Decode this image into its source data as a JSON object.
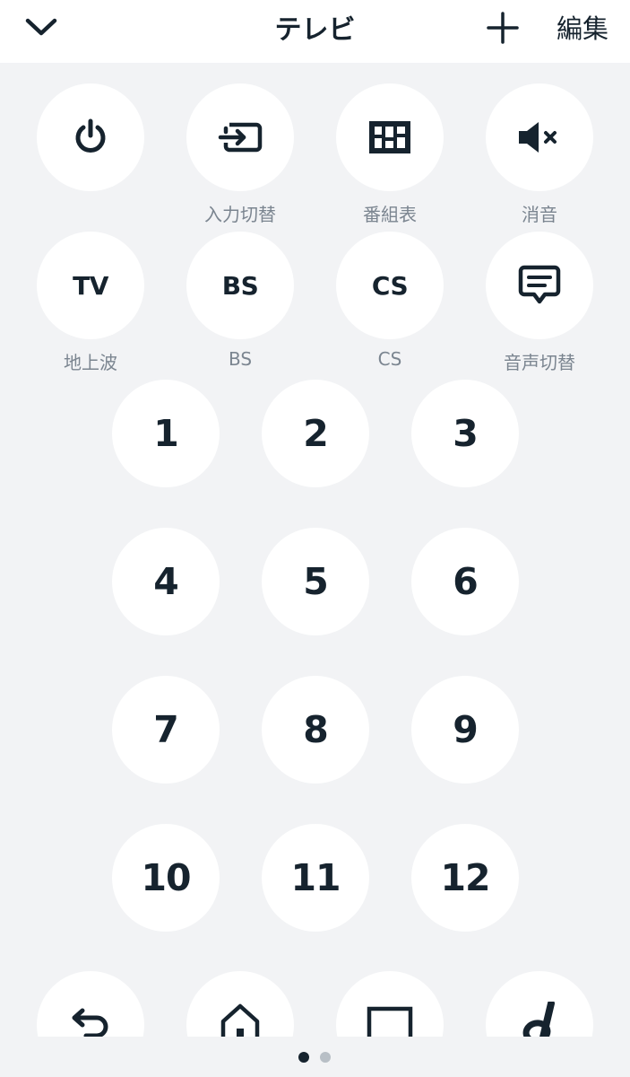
{
  "header": {
    "title": "テレビ",
    "collapse_icon": "chevron-down-icon",
    "add_icon": "plus-icon",
    "edit_label": "編集"
  },
  "row1": [
    {
      "icon": "power-icon",
      "label": ""
    },
    {
      "icon": "input-switch-icon",
      "label": "入力切替"
    },
    {
      "icon": "program-guide-icon",
      "label": "番組表"
    },
    {
      "icon": "mute-icon",
      "label": "消音"
    }
  ],
  "row2": [
    {
      "text": "TV",
      "label": "地上波"
    },
    {
      "text": "BS",
      "label": "BS"
    },
    {
      "text": "CS",
      "label": "CS"
    },
    {
      "icon": "audio-switch-icon",
      "label": "音声切替"
    }
  ],
  "numbers": [
    "1",
    "2",
    "3",
    "4",
    "5",
    "6",
    "7",
    "8",
    "9",
    "10",
    "11",
    "12"
  ],
  "bottom_row": [
    {
      "icon": "back-icon"
    },
    {
      "icon": "home-icon"
    },
    {
      "icon": "square-icon"
    },
    {
      "icon": "d-button-icon"
    }
  ],
  "pager": {
    "pages": 2,
    "current": 1
  },
  "colors": {
    "background": "#f2f3f5",
    "header": "#ffffff",
    "button": "#ffffff",
    "icon": "#16232e",
    "label": "#7b8590",
    "dot_active": "#16232e",
    "dot_inactive": "#b8bfc6"
  }
}
